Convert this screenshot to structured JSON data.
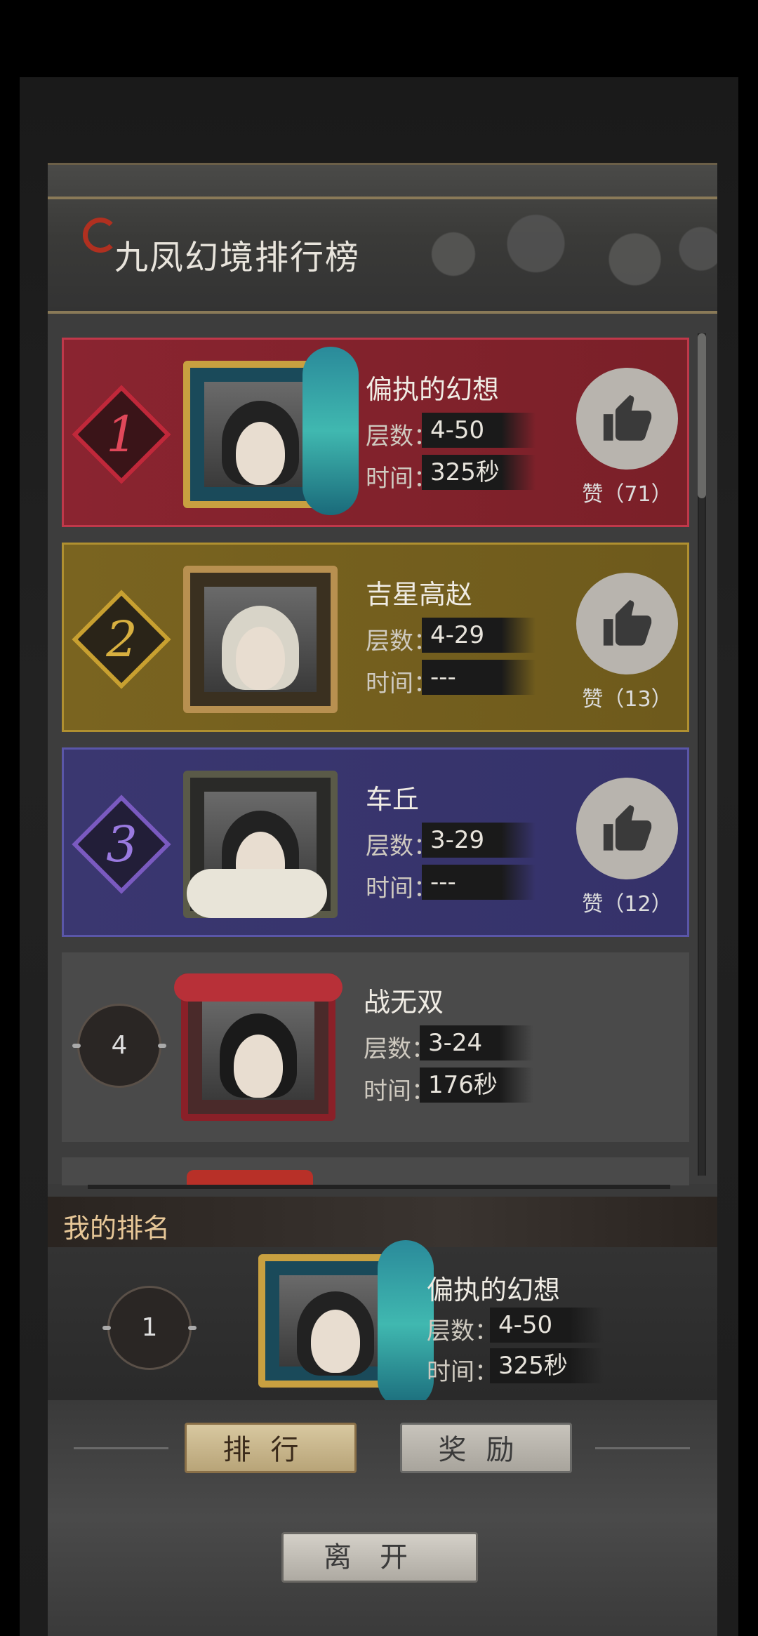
{
  "title": "九凤幻境排行榜",
  "entries": [
    {
      "rank": "1",
      "name": "偏执的幻想",
      "floor_label": "层数：",
      "floor": "4-50",
      "time_label": "时间：",
      "time": "325秒",
      "likes": "赞（71）"
    },
    {
      "rank": "2",
      "name": "吉星高赵",
      "floor_label": "层数：",
      "floor": "4-29",
      "time_label": "时间：",
      "time": "---",
      "likes": "赞（13）"
    },
    {
      "rank": "3",
      "name": "车丘",
      "floor_label": "层数：",
      "floor": "3-29",
      "time_label": "时间：",
      "time": "---",
      "likes": "赞（12）"
    },
    {
      "rank": "4",
      "name": "战无双",
      "floor_label": "层数：",
      "floor": "3-24",
      "time_label": "时间：",
      "time": "176秒"
    }
  ],
  "my_rank": {
    "title": "我的排名",
    "rank": "1",
    "name": "偏执的幻想",
    "floor_label": "层数：",
    "floor": "4-50",
    "time_label": "时间：",
    "time": "325秒"
  },
  "tabs": {
    "rank": "排行",
    "reward": "奖励"
  },
  "leave": "离开",
  "colors": {
    "rank1": "#8a2430",
    "rank2": "#7a6420",
    "rank3": "#3a3770",
    "accent": "#e8c898"
  },
  "icons": {
    "like": "thumbs-up-icon",
    "title": "swirl-icon"
  }
}
